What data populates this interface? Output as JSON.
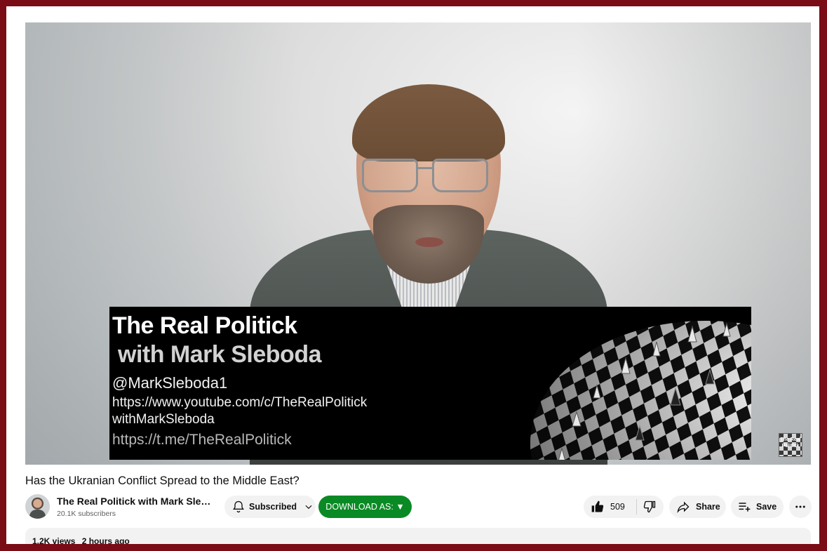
{
  "player": {
    "overlay": {
      "title": "The Real Politick",
      "subtitle": "with Mark Sleboda",
      "handle": "@MarkSleboda1",
      "youtube_url_line1": "https://www.youtube.com/c/TheRealPolitick",
      "youtube_url_line2": "withMarkSleboda",
      "telegram_url": "https://t.me/TheRealPolitick"
    },
    "watermark": "The Real Politick"
  },
  "video": {
    "title": "Has the Ukranian Conflict Spread to the Middle East?"
  },
  "channel": {
    "name": "The Real Politick with Mark Sleboda",
    "subscribers": "20.1K subscribers"
  },
  "actions": {
    "subscribe_label": "Subscribed",
    "download_label": "DOWNLOAD AS: ▼",
    "like_count": "509",
    "share_label": "Share",
    "save_label": "Save"
  },
  "description": {
    "views": "1.2K views",
    "age": "2 hours ago"
  },
  "colors": {
    "frame": "#7a0c16",
    "download_button": "#0a8a24",
    "pill_background": "#f2f2f2"
  },
  "icons": [
    "bell-icon",
    "chevron-down-icon",
    "like-icon",
    "dislike-icon",
    "share-icon",
    "save-playlist-icon",
    "more-icon"
  ]
}
